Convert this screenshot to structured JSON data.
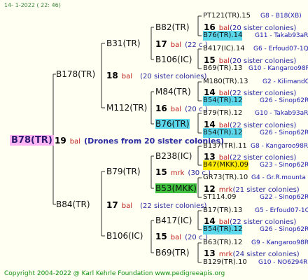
{
  "header": "14-  1-2022  ( 22: 46)",
  "footer": "Copyright 2004-2022 @ Karl Kehrle Foundation    www.pedigreeapis.org",
  "root": {
    "label": "B78(TR)",
    "num": "19",
    "bal": "bal",
    "note": "(Drones from 20 sister colonies)"
  },
  "gen1": [
    {
      "label": "B178(TR)",
      "num": "18",
      "bal": "bal",
      "sis": "(20 sister colonies)"
    },
    {
      "label": "B84(TR)",
      "num": "17",
      "bal": "bal",
      "sis": "(22 sister colonies)"
    }
  ],
  "gen2": [
    {
      "label": "B31(TR)",
      "num": "17",
      "bal": "bal",
      "sis": "(22 c.)"
    },
    {
      "label": "M112(TR)",
      "num": "16",
      "bal": "bal",
      "sis": "(20 c.)"
    },
    {
      "label": "B79(TR)",
      "num": "15",
      "bal": "mrk",
      "sis": "(30 c.)"
    },
    {
      "label": "B106(IC)",
      "num": "15",
      "bal": "bal",
      "sis": "(20 c.)"
    }
  ],
  "gen3": [
    {
      "label": "B82(TR)",
      "num": "16",
      "bal": "bal",
      "sis": "(20 sister colonies)"
    },
    {
      "label": "B106(IC)",
      "num": "15",
      "bal": "bal",
      "sis": "(20 sister colonies)"
    },
    {
      "label": "M84(TR)",
      "num": "14",
      "bal": "bal",
      "sis": "(22 sister colonies)"
    },
    {
      "label": "B76(TR)",
      "num": "14",
      "bal": "bal",
      "sis": "(22 sister colonies)"
    },
    {
      "label": "B238(IC)",
      "num": "13",
      "bal": "bal",
      "sis": "(22 sister colonies)"
    },
    {
      "label": "B53(MKK)",
      "num": "12",
      "bal": "mrk",
      "sis": "(21 sister colonies)"
    },
    {
      "label": "B417(IC)",
      "num": "14",
      "bal": "bal",
      "sis": "(22 sister colonies)"
    },
    {
      "label": "B69(TR)",
      "num": "13",
      "bal": "mrk",
      "sis": "(24 sister colonies)"
    }
  ],
  "gen4": [
    {
      "label": "PT121(TR).15",
      "tag": "G8 - B18(XB)"
    },
    {
      "label": "B76(TR).14",
      "tag": "G11 - Takab93aR"
    },
    {
      "label": "B417(IC).14",
      "tag": "G6 - Erfoud07-1Q"
    },
    {
      "label": "B69(TR).13",
      "tag": "G10 - Kangaroo98R"
    },
    {
      "label": "M180(TR).13",
      "tag": "G2 - KilimandQ"
    },
    {
      "label": "B54(TR).12",
      "tag": "G26 - Sinop62R"
    },
    {
      "label": "B79(TR).12",
      "tag": "G10 - Takab93aR"
    },
    {
      "label": "B54(TR).12",
      "tag": "G26 - Sinop62R"
    },
    {
      "label": "B137(TR).11",
      "tag": "G8 - Kangaroo98R"
    },
    {
      "label": "B47(MKK).09",
      "tag": "G23 - Sinop62R"
    },
    {
      "label": "GR73(TR).10",
      "tag": "G4 - Gr.R.mounta"
    },
    {
      "label": "ST114.09",
      "tag": "G22 - Sinop62R"
    },
    {
      "label": "B17(TR).13",
      "tag": "G5 - Erfoud07-1Q"
    },
    {
      "label": "B54(TR).12",
      "tag": "G26 - Sinop62R"
    },
    {
      "label": "B63(TR).12",
      "tag": "G9 - Kangaroo98R"
    },
    {
      "label": "B129(TR).10",
      "tag": "G10 - NO6294R"
    }
  ]
}
